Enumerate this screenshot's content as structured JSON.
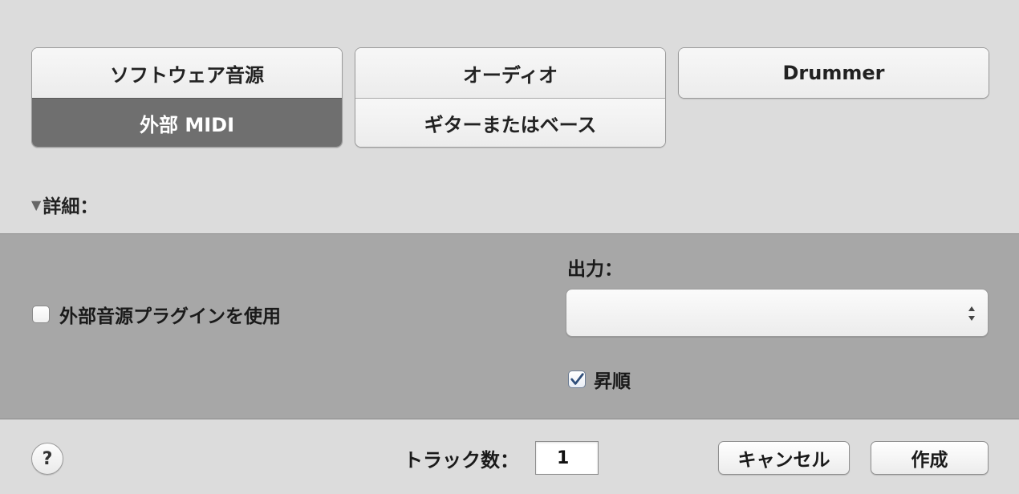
{
  "track_types": {
    "software_instrument": "ソフトウェア音源",
    "external_midi": "外部 MIDI",
    "audio": "オーディオ",
    "guitar_bass": "ギターまたはベース",
    "drummer": "Drummer",
    "selected": "external_midi"
  },
  "details": {
    "toggle_label": "詳細：",
    "toggle_icon": "disclosure-triangle-down"
  },
  "panel": {
    "use_plugin_label": "外部音源プラグインを使用",
    "use_plugin_checked": false,
    "output_label": "出力：",
    "output_value": "",
    "ascending_label": "昇順",
    "ascending_checked": true
  },
  "footer": {
    "help_label": "?",
    "track_count_label": "トラック数：",
    "track_count_value": "1",
    "cancel_label": "キャンセル",
    "create_label": "作成"
  },
  "colors": {
    "background": "#dcdcdc",
    "panel": "#a7a7a7",
    "selected_button": "#6f6f6f",
    "check_accent": "#2f4e7a"
  }
}
